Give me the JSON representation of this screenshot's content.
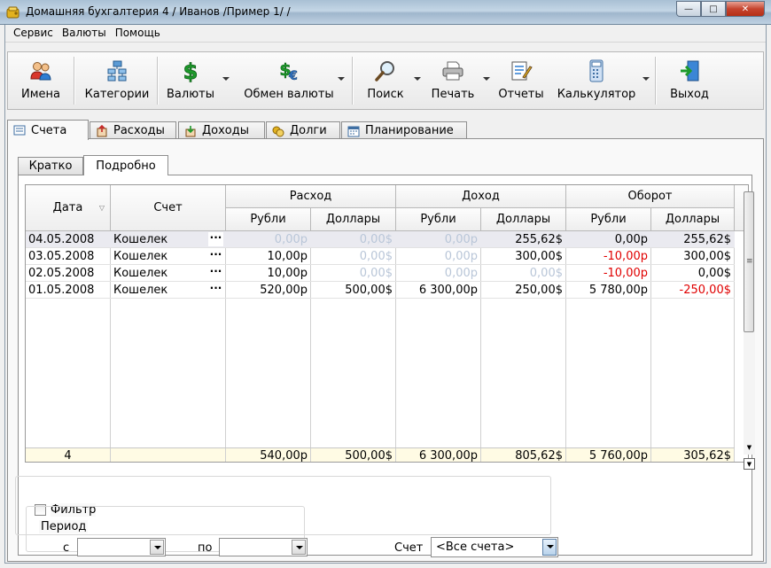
{
  "window": {
    "title": "Домашняя бухгалтерия 4  / Иванов /Пример 1/ /",
    "minimize_glyph": "—",
    "maximize_glyph": "□",
    "close_glyph": "✕"
  },
  "menu": {
    "items": [
      "Сервис",
      "Валюты",
      "Помощь"
    ]
  },
  "toolbar": {
    "items": [
      {
        "label": "Имена",
        "icon": "people-icon"
      },
      {
        "label": "Категории",
        "icon": "categories-tree-icon"
      },
      {
        "label": "Валюты",
        "icon": "dollar-icon"
      },
      {
        "label": "Обмен валюты",
        "icon": "currency-exchange-icon"
      },
      {
        "label": "Поиск",
        "icon": "magnifier-icon"
      },
      {
        "label": "Печать",
        "icon": "printer-icon"
      },
      {
        "label": "Отчеты",
        "icon": "report-icon"
      },
      {
        "label": "Калькулятор",
        "icon": "calculator-icon"
      },
      {
        "label": "Выход",
        "icon": "exit-door-icon"
      }
    ]
  },
  "tabs": {
    "main": [
      {
        "label": "Счета",
        "icon": "accounts-icon",
        "active": true
      },
      {
        "label": "Расходы",
        "icon": "expenses-icon",
        "active": false
      },
      {
        "label": "Доходы",
        "icon": "income-icon",
        "active": false
      },
      {
        "label": "Долги",
        "icon": "debts-icon",
        "active": false
      },
      {
        "label": "Планирование",
        "icon": "planning-icon",
        "active": false
      }
    ],
    "sub": [
      {
        "label": "Кратко",
        "active": false
      },
      {
        "label": "Подробно",
        "active": true
      }
    ]
  },
  "grid": {
    "columns": {
      "date": "Дата",
      "account": "Счет",
      "expense": "Расход",
      "income": "Доход",
      "turnover": "Оборот",
      "rub": "Рубли",
      "usd": "Доллары"
    },
    "sort_glyph": "▽",
    "dots_glyph": "···",
    "rows": [
      {
        "date": "04.05.2008",
        "account": "Кошелек",
        "exp_rub": "0,00р",
        "exp_usd": "0,00$",
        "inc_rub": "0,00р",
        "inc_usd": "255,62$",
        "tur_rub": "0,00р",
        "tur_usd": "255,62$"
      },
      {
        "date": "03.05.2008",
        "account": "Кошелек",
        "exp_rub": "10,00р",
        "exp_usd": "0,00$",
        "inc_rub": "0,00р",
        "inc_usd": "300,00$",
        "tur_rub": "-10,00р",
        "tur_usd": "300,00$"
      },
      {
        "date": "02.05.2008",
        "account": "Кошелек",
        "exp_rub": "10,00р",
        "exp_usd": "0,00$",
        "inc_rub": "0,00р",
        "inc_usd": "0,00$",
        "tur_rub": "-10,00р",
        "tur_usd": "0,00$"
      },
      {
        "date": "01.05.2008",
        "account": "Кошелек",
        "exp_rub": "520,00р",
        "exp_usd": "500,00$",
        "inc_rub": "6 300,00р",
        "inc_usd": "250,00$",
        "tur_rub": "5 780,00р",
        "tur_usd": "-250,00$"
      }
    ],
    "totals": {
      "count": "4",
      "exp_rub": "540,00р",
      "exp_usd": "500,00$",
      "inc_rub": "6 300,00р",
      "inc_usd": "805,62$",
      "tur_rub": "5 760,00р",
      "tur_usd": "305,62$"
    },
    "scroll_up_glyph": "▲",
    "scroll_down_glyph": "▼",
    "grip_glyph": "≡"
  },
  "filter": {
    "label": "Фильтр",
    "period_label": "Период",
    "from_label": "с",
    "to_label": "по",
    "from_value": "",
    "to_value": "",
    "account_label": "Счет",
    "account_value": "<Все счета>"
  },
  "colors": {
    "negative": "#e00000",
    "muted_zero": "#b9c6d8",
    "selected_row": "#eaeaf0",
    "totals_row": "#fffbe4"
  }
}
